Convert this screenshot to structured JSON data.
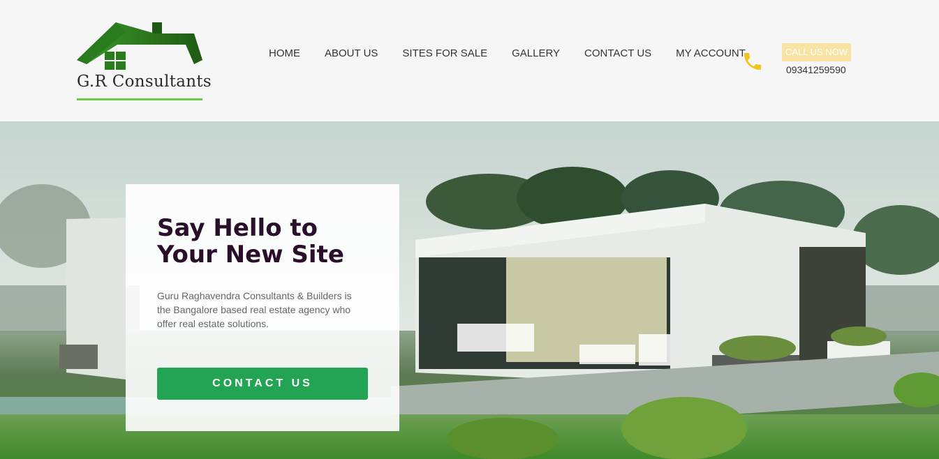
{
  "brand": {
    "name": "G.R Consultants",
    "logo_icon": "house-roof-icon",
    "colors": {
      "logo_green": "#2a7a1e",
      "underline": "#6ccb4a"
    }
  },
  "nav": {
    "items": [
      {
        "label": "HOME"
      },
      {
        "label": "ABOUT US"
      },
      {
        "label": "SITES FOR SALE"
      },
      {
        "label": "GALLERY"
      },
      {
        "label": "CONTACT US"
      },
      {
        "label": "MY ACCOUNT"
      }
    ]
  },
  "call": {
    "icon": "phone-icon",
    "badge": "CALL US NOW",
    "number": "09341259590",
    "colors": {
      "icon": "#f0c419",
      "badge_bg": "#f8e3a2"
    }
  },
  "hero": {
    "title": "Say Hello to Your New Site",
    "description": "Guru Raghavendra Consultants & Builders is the Bangalore based real estate agency who offer real estate solutions.",
    "cta_label": "CONTACT US",
    "colors": {
      "cta_bg": "#23a455",
      "title": "#2a0f2a"
    }
  }
}
